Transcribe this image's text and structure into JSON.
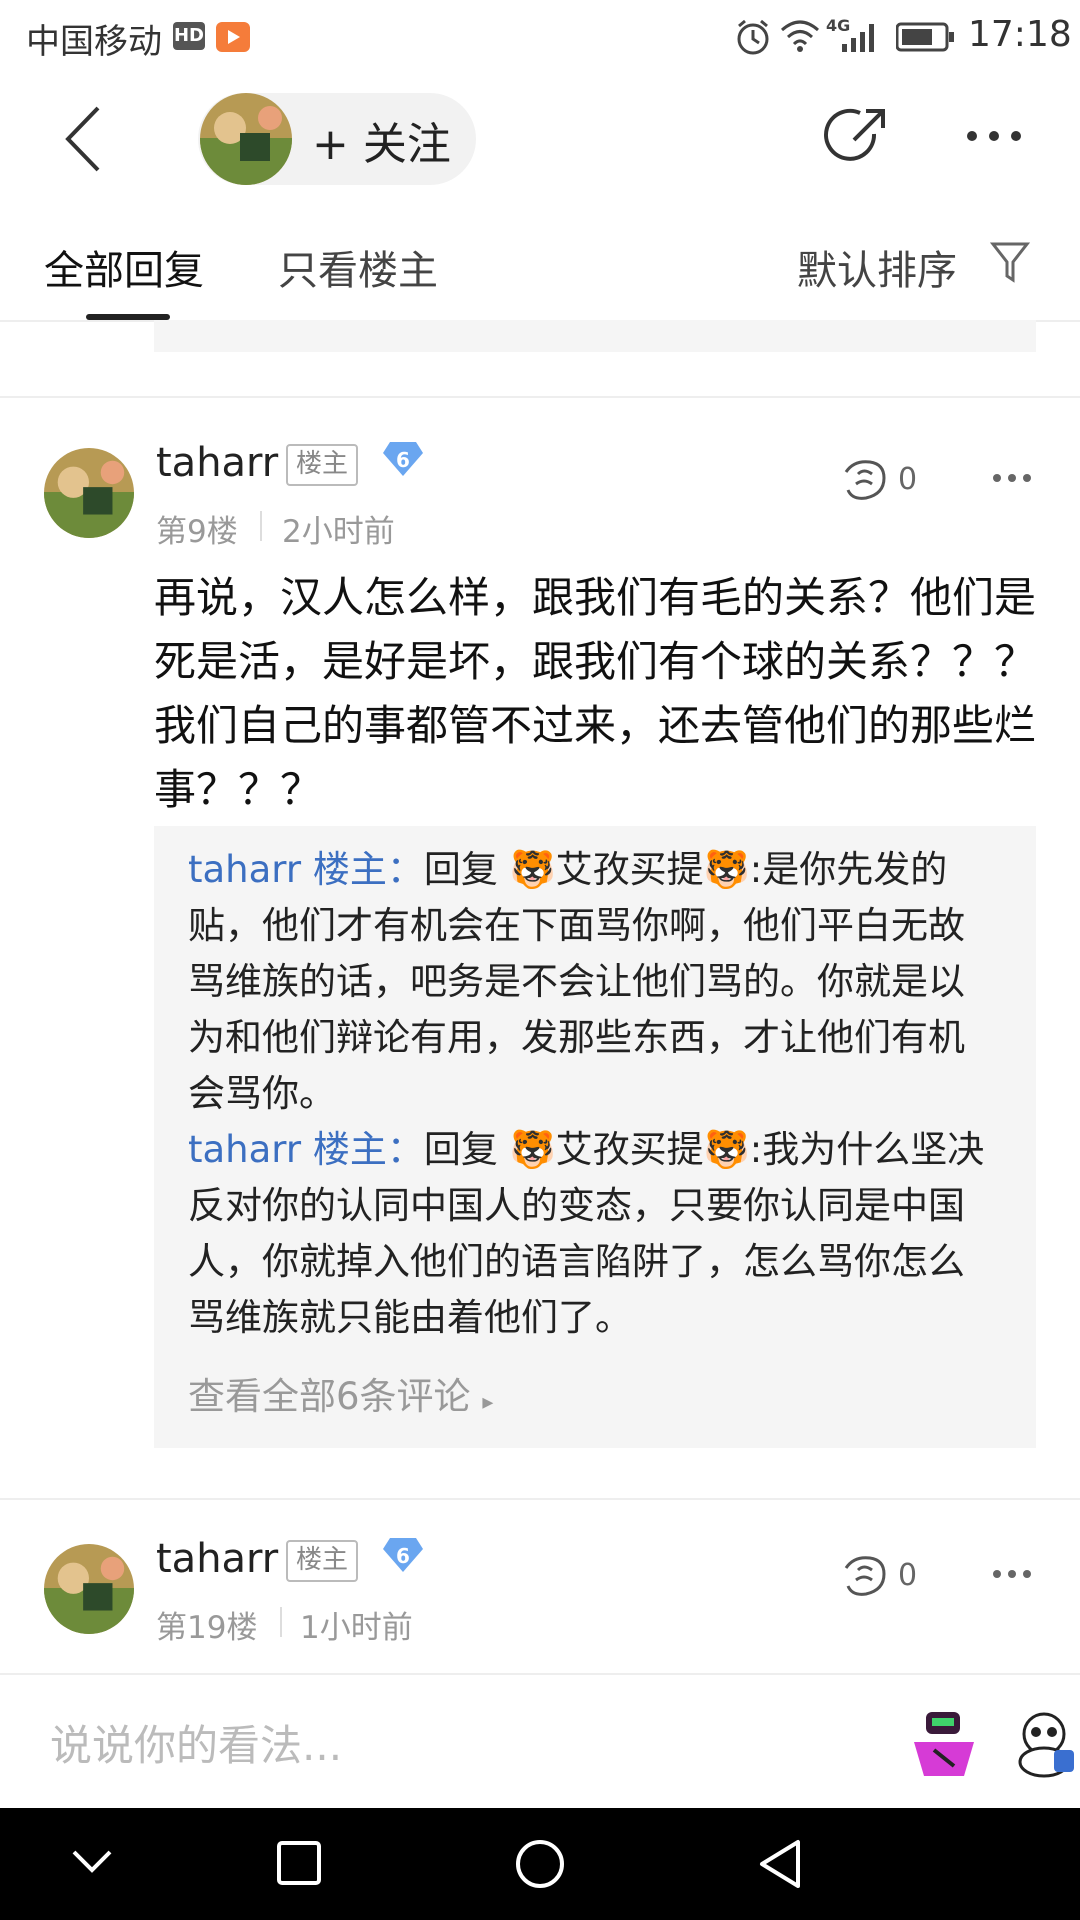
{
  "status_bar": {
    "carrier": "中国移动",
    "hd": "HD",
    "network": "4G",
    "time": "17:18"
  },
  "header": {
    "follow_label": "+ 关注",
    "icons": [
      "back-icon",
      "share-icon",
      "more-icon"
    ]
  },
  "tabs": {
    "all_replies": "全部回复",
    "owner_only": "只看楼主",
    "sort_label": "默认排序"
  },
  "posts": [
    {
      "username": "taharr",
      "owner_badge": "楼主",
      "level": "6",
      "floor": "第9楼",
      "time": "2小时前",
      "likes": "0",
      "body": "再说，汉人怎么样，跟我们有毛的关系？他们是死是活，是好是坏，跟我们有个球的关系？？？我们自己的事都管不过来，还去管他们的那些烂事？？？",
      "replies": [
        {
          "author": "taharr 楼主：",
          "prefix": "回复 ",
          "target": "🐯艾孜买提🐯",
          "text": ":是你先发的贴，他们才有机会在下面骂你啊，他们平白无故骂维族的话，吧务是不会让他们骂的。你就是以为和他们辩论有用，发那些东西，才让他们有机会骂你。"
        },
        {
          "author": "taharr 楼主：",
          "prefix": "回复 ",
          "target": "🐯艾孜买提🐯",
          "text": ":我为什么坚决反对你的认同中国人的变态，只要你认同是中国人，你就掉入他们的语言陷阱了，怎么骂你怎么骂维族就只能由着他们了。"
        }
      ],
      "view_all": "查看全部6条评论"
    },
    {
      "username": "taharr",
      "owner_badge": "楼主",
      "level": "6",
      "floor": "第19楼",
      "time": "1小时前",
      "likes": "0"
    }
  ],
  "input": {
    "placeholder": "说说你的看法..."
  },
  "colors": {
    "link_blue": "#3c6fc1",
    "level_badge": "#6aa6f0",
    "muted": "#999999"
  }
}
